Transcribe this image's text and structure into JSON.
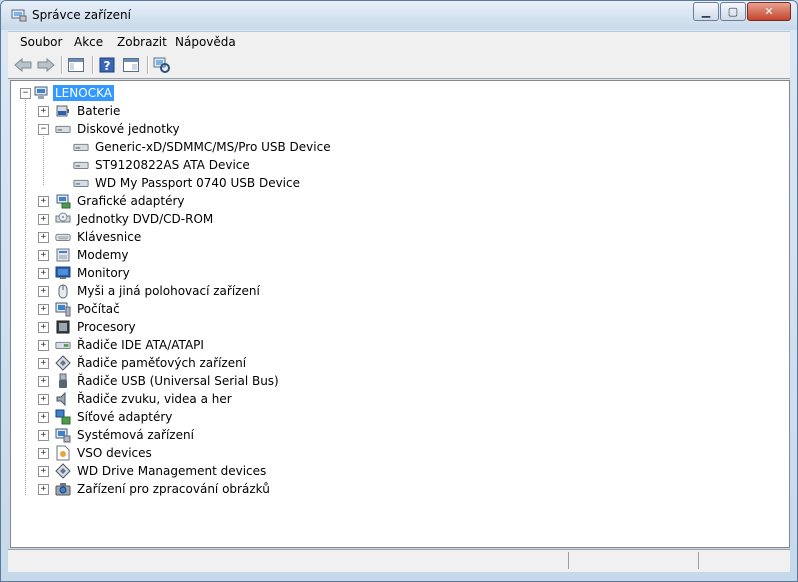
{
  "window": {
    "title": "Správce zařízení",
    "minimize_icon": "minimize-icon",
    "maximize_icon": "maximize-icon",
    "close_icon": "close-icon"
  },
  "menu": [
    "Soubor",
    "Akce",
    "Zobrazit",
    "Nápověda"
  ],
  "toolbar": [
    "back-arrow-icon",
    "forward-arrow-icon",
    "show-hide-console-tree-icon",
    "help-icon",
    "properties-icon",
    "scan-hardware-icon"
  ],
  "tree": {
    "root": "LENOCKA",
    "categories": [
      {
        "label": "Baterie",
        "icon": "battery-icon",
        "expanded": false
      },
      {
        "label": "Diskové jednotky",
        "icon": "disk-drive-icon",
        "expanded": true,
        "children": [
          "Generic-xD/SDMMC/MS/Pro  USB Device",
          "ST9120822AS ATA Device",
          "WD My Passport 0740 USB Device"
        ]
      },
      {
        "label": "Grafické adaptéry",
        "icon": "display-adapter-icon",
        "expanded": false
      },
      {
        "label": "Jednotky DVD/CD-ROM",
        "icon": "dvd-drive-icon",
        "expanded": false
      },
      {
        "label": "Klávesnice",
        "icon": "keyboard-icon",
        "expanded": false
      },
      {
        "label": "Modemy",
        "icon": "modem-icon",
        "expanded": false
      },
      {
        "label": "Monitory",
        "icon": "monitor-icon",
        "expanded": false
      },
      {
        "label": "Myši a jiná polohovací zařízení",
        "icon": "mouse-icon",
        "expanded": false
      },
      {
        "label": "Počítač",
        "icon": "computer-icon",
        "expanded": false
      },
      {
        "label": "Procesory",
        "icon": "processor-icon",
        "expanded": false
      },
      {
        "label": "Řadiče IDE ATA/ATAPI",
        "icon": "ide-controller-icon",
        "expanded": false
      },
      {
        "label": "Řadiče paměťových zařízení",
        "icon": "storage-controller-icon",
        "expanded": false
      },
      {
        "label": "Řadiče USB (Universal Serial Bus)",
        "icon": "usb-controller-icon",
        "expanded": false
      },
      {
        "label": "Řadiče zvuku, videa a her",
        "icon": "sound-icon",
        "expanded": false
      },
      {
        "label": "Síťové adaptéry",
        "icon": "network-adapter-icon",
        "expanded": false
      },
      {
        "label": "Systémová zařízení",
        "icon": "system-device-icon",
        "expanded": false
      },
      {
        "label": "VSO devices",
        "icon": "vso-device-icon",
        "expanded": false
      },
      {
        "label": "WD Drive Management devices",
        "icon": "wd-device-icon",
        "expanded": false
      },
      {
        "label": "Zařízení pro zpracování obrázků",
        "icon": "imaging-device-icon",
        "expanded": false
      }
    ]
  },
  "colors": {
    "selection": "#3399ff",
    "frame": "#c6d9ea"
  }
}
